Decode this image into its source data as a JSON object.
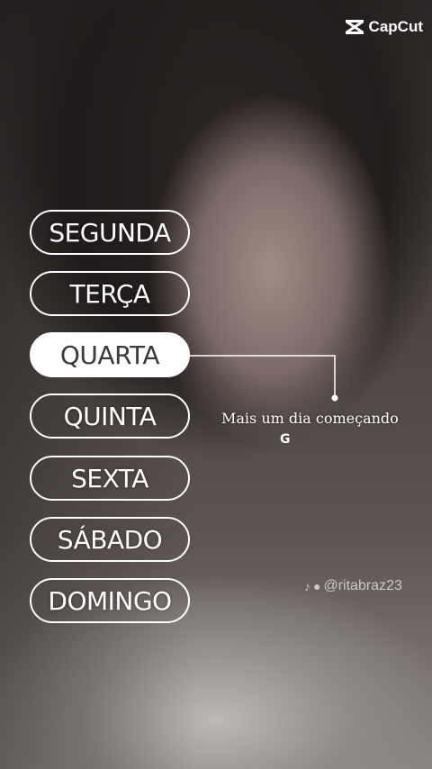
{
  "brand": {
    "name": "CapCut"
  },
  "days": [
    {
      "label": "SEGUNDA",
      "active": false
    },
    {
      "label": "TERÇA",
      "active": false
    },
    {
      "label": "QUARTA",
      "active": true
    },
    {
      "label": "QUINTA",
      "active": false
    },
    {
      "label": "SEXTA",
      "active": false
    },
    {
      "label": "SÁBADO",
      "active": false
    },
    {
      "label": "DOMINGO",
      "active": false
    }
  ],
  "caption": {
    "text": "Mais um dia começando",
    "glyph": "G"
  },
  "watermark": {
    "handle": "@ritabraz23",
    "icons": [
      "tiktok-icon",
      "user-icon"
    ]
  },
  "colors": {
    "pill_border": "#ffffff",
    "active_fill": "#ffffff",
    "active_text": "#3a3a3a"
  }
}
